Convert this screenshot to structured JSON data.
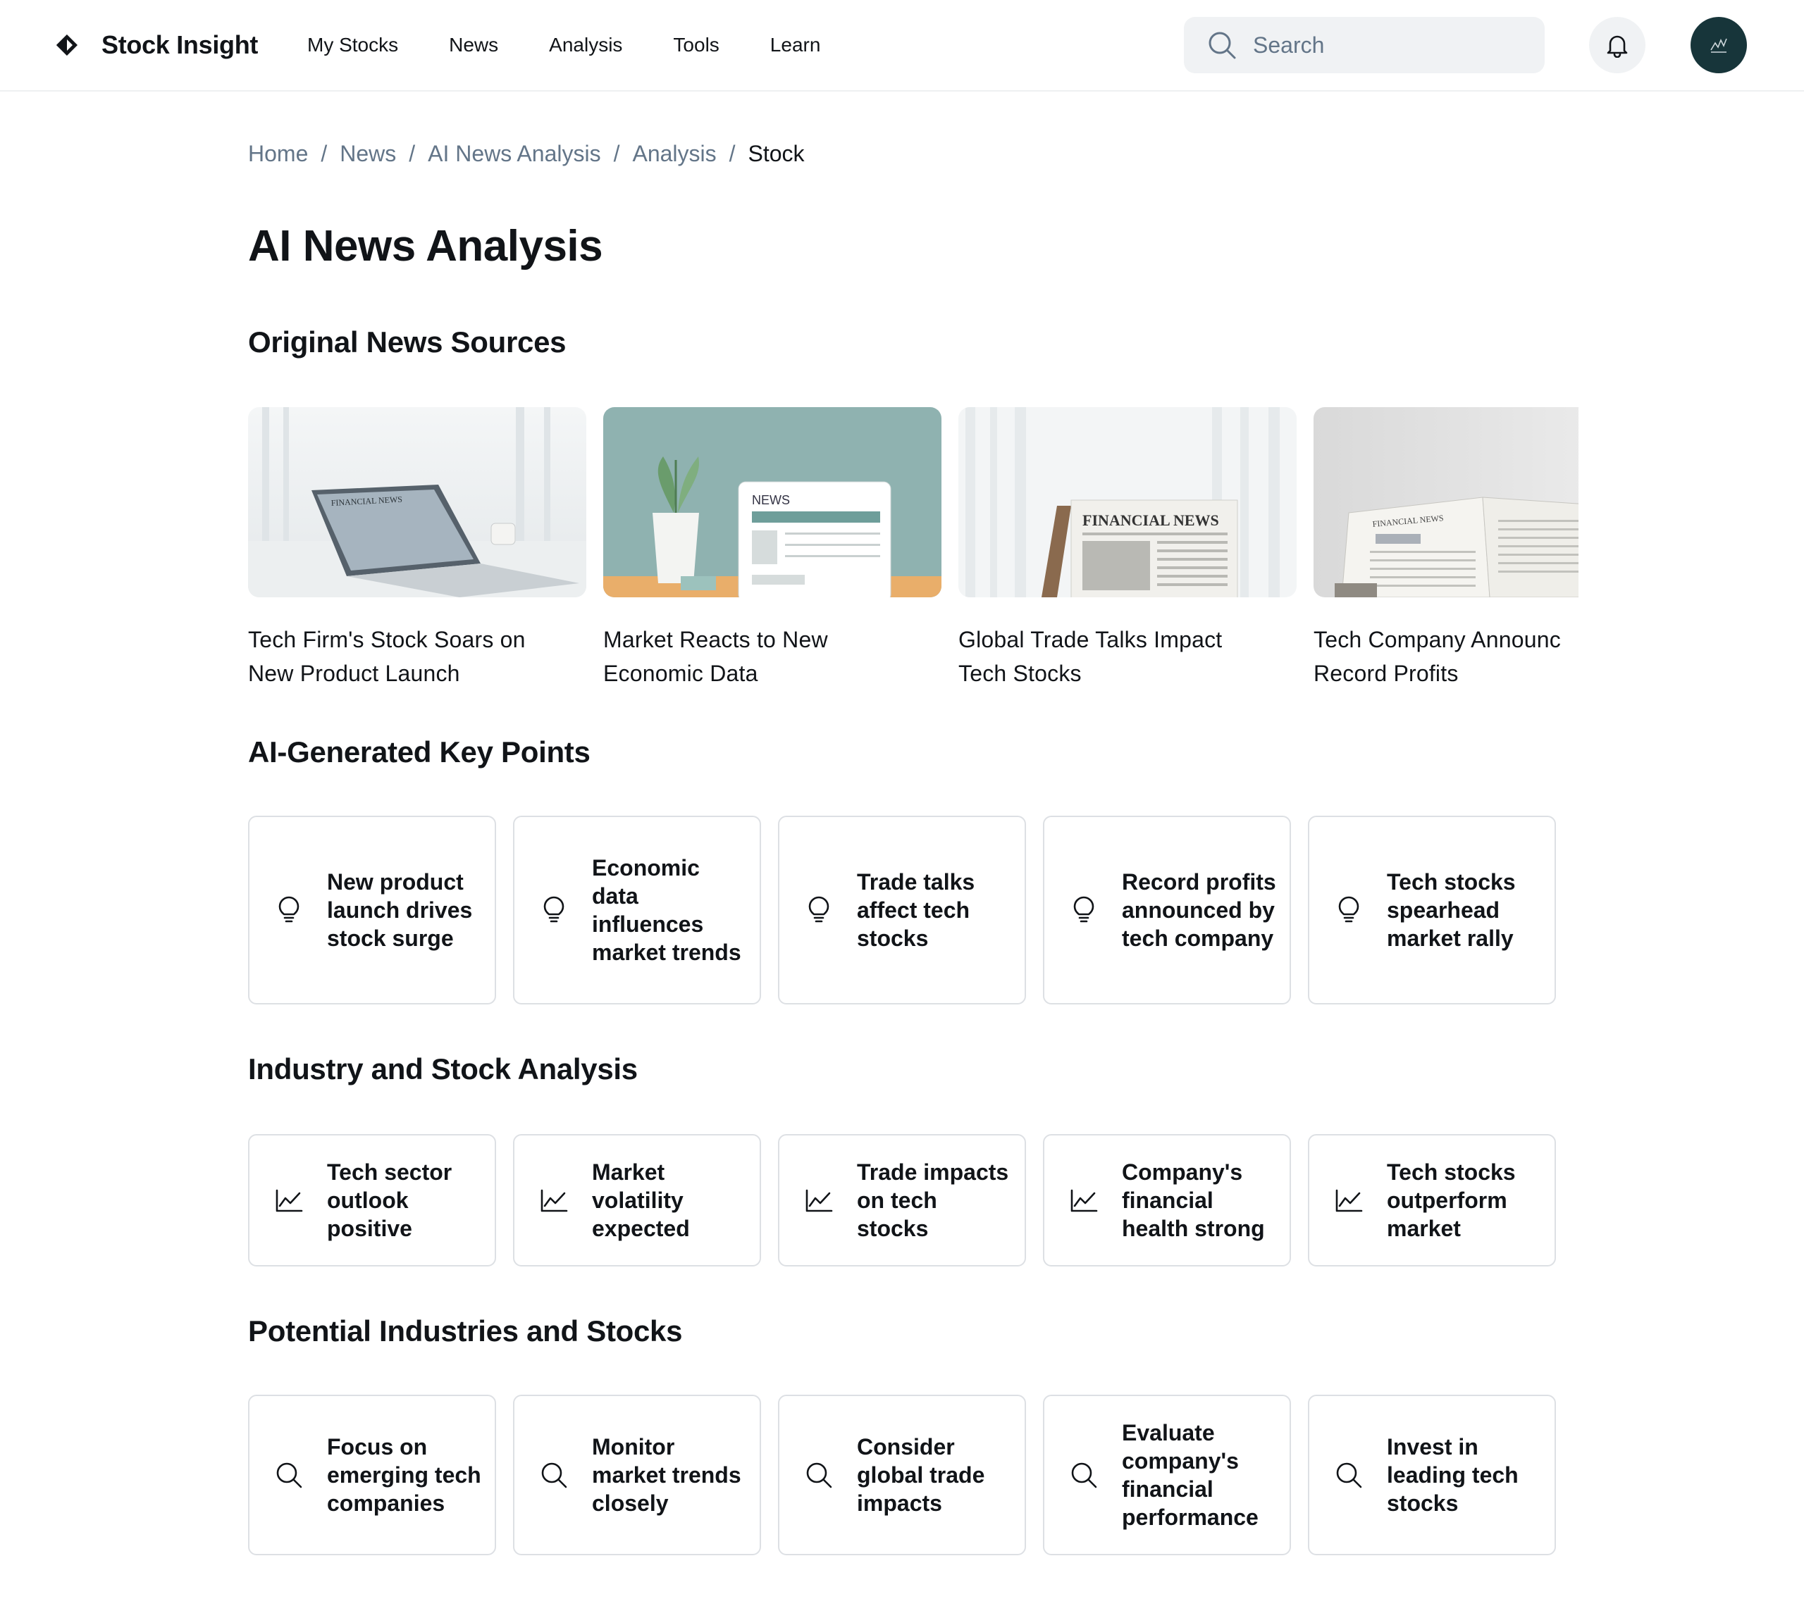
{
  "header": {
    "brand": "Stock Insight",
    "nav": [
      "My Stocks",
      "News",
      "Analysis",
      "Tools",
      "Learn"
    ],
    "search_placeholder": "Search"
  },
  "breadcrumb": [
    "Home",
    "News",
    "AI News Analysis",
    "Analysis",
    "Stock"
  ],
  "page_title": "AI News Analysis",
  "sections": {
    "news": {
      "title": "Original News Sources",
      "items": [
        {
          "title_line1": "Tech Firm's Stock Soars on",
          "title_line2": "New Product Launch",
          "image_text": "FINANCIAL NEWS"
        },
        {
          "title_line1": "Market Reacts to New",
          "title_line2": "Economic Data",
          "image_text": "NEWS"
        },
        {
          "title_line1": "Global Trade Talks Impact",
          "title_line2": "Tech Stocks",
          "image_text": "FINANCIAL NEWS"
        },
        {
          "title_line1": "Tech Company Announc",
          "title_line2": "Record Profits",
          "image_text": "FINANCIAL NEWS"
        }
      ]
    },
    "key_points": {
      "title": "AI-Generated Key Points",
      "icon": "lightbulb-icon",
      "items": [
        "New product launch drives stock surge",
        "Economic data influences market trends",
        "Trade talks affect tech stocks",
        "Record profits announced by tech company",
        "Tech stocks spearhead market rally"
      ]
    },
    "industry": {
      "title": "Industry and Stock Analysis",
      "icon": "chart-line-icon",
      "items": [
        "Tech sector outlook positive",
        "Market volatility expected",
        "Trade impacts on tech stocks",
        "Company's financial health strong",
        "Tech stocks outperform market"
      ]
    },
    "potential": {
      "title": "Potential Industries and Stocks",
      "icon": "search-icon",
      "items": [
        "Focus on emerging tech companies",
        "Monitor market trends closely",
        "Consider global trade impacts",
        "Evaluate company's financial performance",
        "Invest in leading tech stocks"
      ]
    }
  },
  "colors": {
    "text": "#111418",
    "muted": "#637588",
    "card_border": "#dde0e4",
    "search_bg": "#f0f2f4",
    "avatar_bg": "#17353a"
  }
}
